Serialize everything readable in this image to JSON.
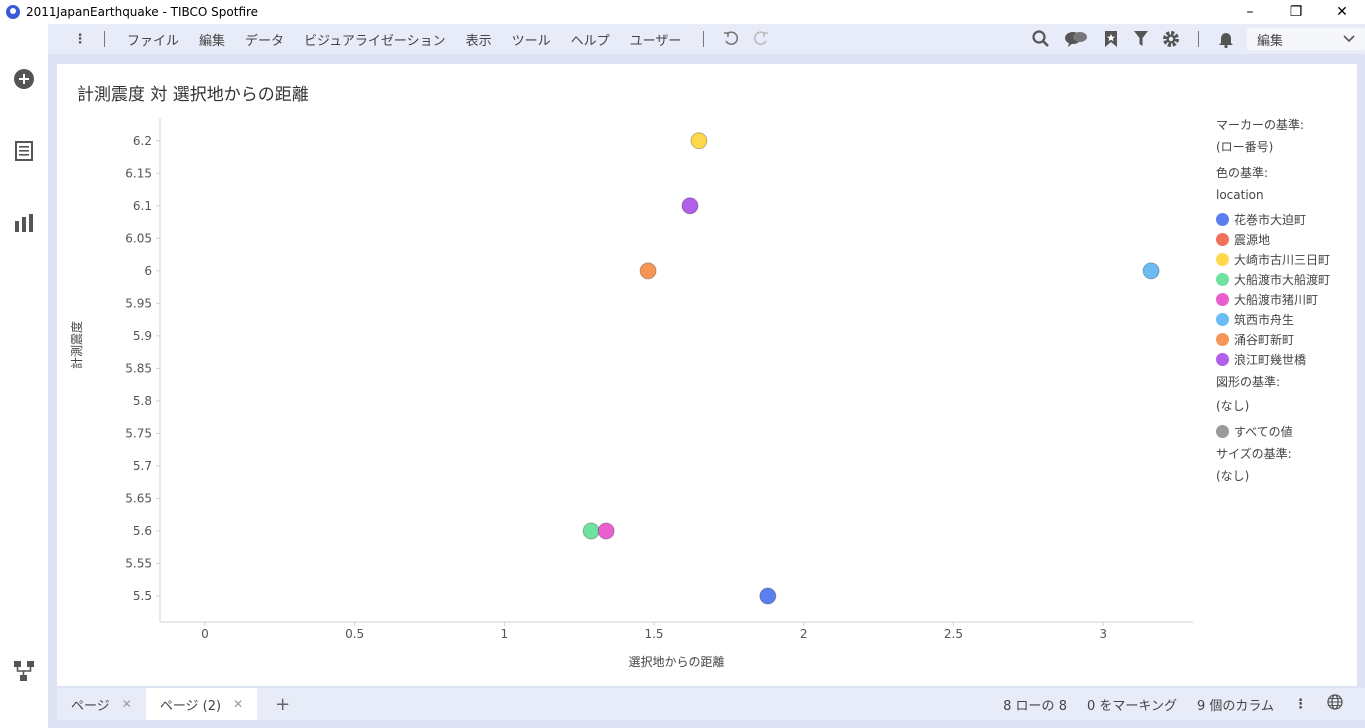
{
  "window": {
    "title": "2011JapanEarthquake - TIBCO Spotfire",
    "minimize_icon": "minimize-icon",
    "maximize_icon": "restore-icon",
    "close_icon": "close-icon"
  },
  "menu": {
    "items": [
      "ファイル",
      "編集",
      "データ",
      "ビジュアライゼーション",
      "表示",
      "ツール",
      "ヘルプ",
      "ユーザー"
    ],
    "mode_select": "編集"
  },
  "visualization": {
    "title": "計測震度 対 選択地からの距離"
  },
  "chart_data": {
    "type": "scatter",
    "xlabel": "選択地からの距離",
    "ylabel": "計測震度",
    "xlim": [
      -0.15,
      3.3
    ],
    "ylim": [
      5.46,
      6.235
    ],
    "x_ticks": [
      "0",
      "0.5",
      "1",
      "1.5",
      "2",
      "2.5",
      "3"
    ],
    "x_tick_values": [
      0,
      0.5,
      1,
      1.5,
      2,
      2.5,
      3
    ],
    "y_ticks": [
      "5.5",
      "5.55",
      "5.6",
      "5.65",
      "5.7",
      "5.75",
      "5.8",
      "5.85",
      "5.9",
      "5.95",
      "6",
      "6.05",
      "6.1",
      "6.15",
      "6.2"
    ],
    "y_tick_values": [
      5.5,
      5.55,
      5.6,
      5.65,
      5.7,
      5.75,
      5.8,
      5.85,
      5.9,
      5.95,
      6.0,
      6.05,
      6.1,
      6.15,
      6.2
    ],
    "points": [
      {
        "location": "花巻市大迫町",
        "x": 1.88,
        "y": 5.5,
        "color": "#5b7ff0"
      },
      {
        "location": "大崎市古川三日町",
        "x": 1.65,
        "y": 6.2,
        "color": "#ffd84d"
      },
      {
        "location": "大船渡市大船渡町",
        "x": 1.29,
        "y": 5.6,
        "color": "#6ee3a0"
      },
      {
        "location": "大船渡市猪川町",
        "x": 1.34,
        "y": 5.6,
        "color": "#ea5fd0"
      },
      {
        "location": "筑西市舟生",
        "x": 3.16,
        "y": 6.0,
        "color": "#6bbcf2"
      },
      {
        "location": "涌谷町新町",
        "x": 1.48,
        "y": 6.0,
        "color": "#f79557"
      },
      {
        "location": "浪江町幾世橋",
        "x": 1.62,
        "y": 6.1,
        "color": "#b15ee8"
      }
    ]
  },
  "legend": {
    "marker_by_label": "マーカーの基準:",
    "marker_by_value": "(ロー番号)",
    "color_by_label": "色の基準:",
    "color_by_value": "location",
    "items": [
      {
        "label": "花巻市大迫町",
        "color": "#5b7ff0"
      },
      {
        "label": "震源地",
        "color": "#f0705a"
      },
      {
        "label": "大崎市古川三日町",
        "color": "#ffd84d"
      },
      {
        "label": "大船渡市大船渡町",
        "color": "#6ee3a0"
      },
      {
        "label": "大船渡市猪川町",
        "color": "#ea5fd0"
      },
      {
        "label": "筑西市舟生",
        "color": "#6bbcf2"
      },
      {
        "label": "涌谷町新町",
        "color": "#f79557"
      },
      {
        "label": "浪江町幾世橋",
        "color": "#b15ee8"
      }
    ],
    "shape_by_label": "図形の基準:",
    "shape_by_value": "(なし)",
    "shape_item": {
      "label": "すべての値",
      "color": "#9a9a9a"
    },
    "size_by_label": "サイズの基準:",
    "size_by_value": "(なし)"
  },
  "pages": [
    {
      "label": "ページ",
      "active": false
    },
    {
      "label": "ページ (2)",
      "active": true
    }
  ],
  "status": {
    "rows": "8 ローの 8",
    "marked": "0 をマーキング",
    "columns": "9 個のカラム"
  }
}
